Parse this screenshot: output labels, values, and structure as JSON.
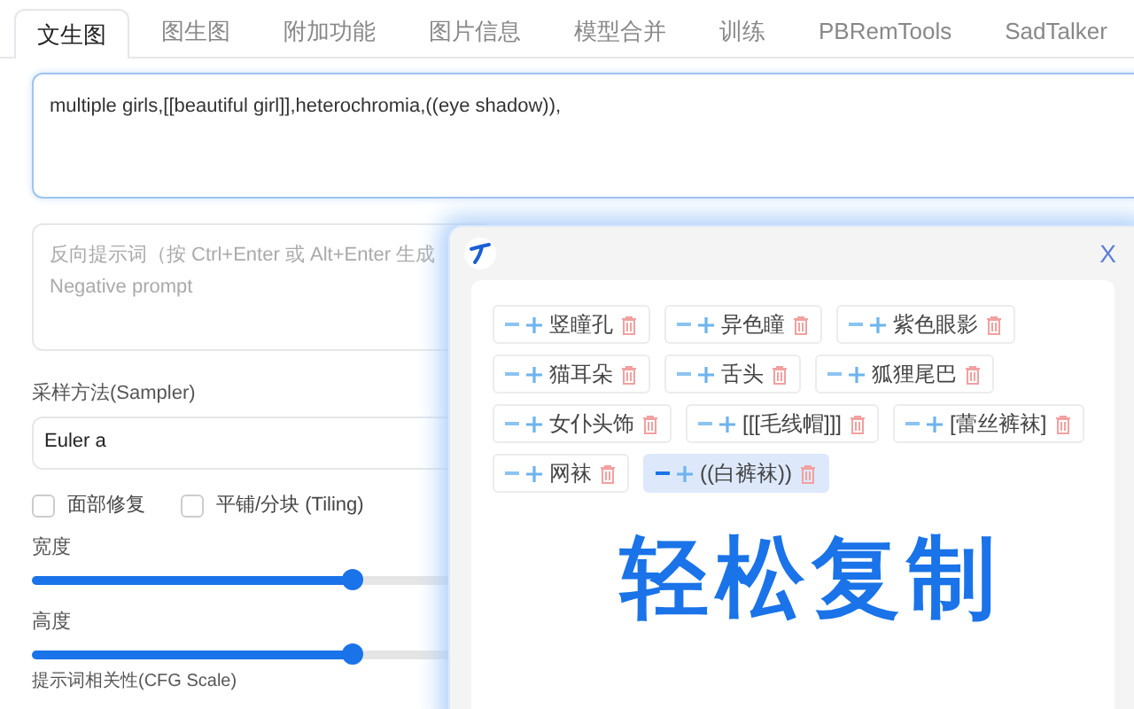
{
  "tabs": [
    {
      "label": "文生图",
      "selected": true
    },
    {
      "label": "图生图",
      "selected": false
    },
    {
      "label": "附加功能",
      "selected": false
    },
    {
      "label": "图片信息",
      "selected": false
    },
    {
      "label": "模型合并",
      "selected": false
    },
    {
      "label": "训练",
      "selected": false
    },
    {
      "label": "PBRemTools",
      "selected": false
    },
    {
      "label": "SadTalker",
      "selected": false
    }
  ],
  "prompt": {
    "value": "multiple girls,[[beautiful girl]],heterochromia,((eye shadow)),"
  },
  "negative_prompt": {
    "placeholder": "反向提示词（按 Ctrl+Enter 或 Alt+Enter 生成\nNegative prompt"
  },
  "sampler": {
    "label": "采样方法(Sampler)",
    "value": "Euler a"
  },
  "checkboxes": [
    {
      "label": "面部修复",
      "checked": false
    },
    {
      "label": "平铺/分块 (Tiling)",
      "checked": false
    }
  ],
  "sliders": [
    {
      "label": "宽度",
      "level": 0.3
    },
    {
      "label": "高度",
      "level": 0.3
    }
  ],
  "cfg_label": "提示词相关性(CFG Scale)",
  "popup": {
    "close": "X",
    "tags": [
      {
        "label": "竖瞳孔",
        "selected": false
      },
      {
        "label": "异色瞳",
        "selected": false
      },
      {
        "label": "紫色眼影",
        "selected": false
      },
      {
        "label": "猫耳朵",
        "selected": false
      },
      {
        "label": "舌头",
        "selected": false
      },
      {
        "label": "狐狸尾巴",
        "selected": false
      },
      {
        "label": "女仆头饰",
        "selected": false
      },
      {
        "label": "[[[毛线帽]]]",
        "selected": false
      },
      {
        "label": "[蕾丝裤袜]",
        "selected": false
      },
      {
        "label": "网袜",
        "selected": false
      },
      {
        "label": "((白裤袜))",
        "selected": true
      }
    ],
    "banner": "轻松复制"
  }
}
